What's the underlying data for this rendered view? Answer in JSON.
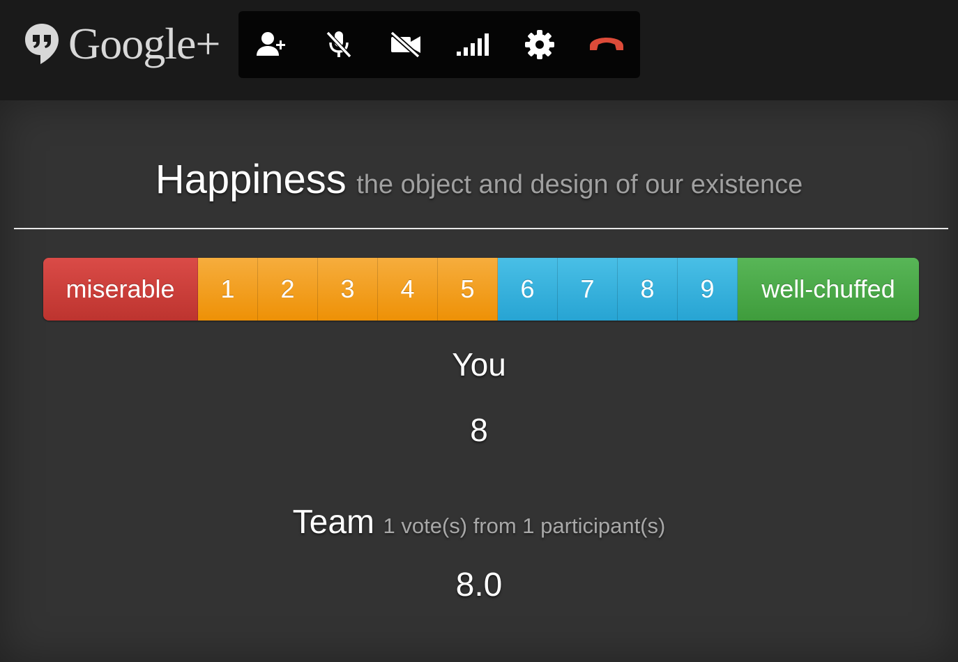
{
  "header": {
    "brand": "Google+",
    "toolbar": [
      {
        "icon": "invite-person-icon",
        "action": "invite"
      },
      {
        "icon": "mic-muted-icon",
        "action": "mute-mic"
      },
      {
        "icon": "camera-off-icon",
        "action": "camera"
      },
      {
        "icon": "signal-bars-icon",
        "action": "bandwidth"
      },
      {
        "icon": "gear-icon",
        "action": "settings"
      },
      {
        "icon": "hang-up-icon",
        "action": "hang-up"
      }
    ],
    "colors": {
      "hangup": "#dd4b39",
      "bar": "#1a1a1a",
      "toolbar": "#050505"
    }
  },
  "main": {
    "title": "Happiness",
    "subtitle": "the object and design of our existence",
    "scale": {
      "low_label": "miserable",
      "high_label": "well-chuffed",
      "numbers": [
        "1",
        "2",
        "3",
        "4",
        "5",
        "6",
        "7",
        "8",
        "9"
      ]
    },
    "you": {
      "label": "You",
      "value": "8"
    },
    "team": {
      "label": "Team",
      "detail": "1 vote(s) from 1 participant(s)",
      "value": "8.0"
    },
    "colors": {
      "miserable": "#c9302c",
      "low": "#f0a030",
      "high": "#31b0d5",
      "chuffed": "#47a447"
    }
  }
}
